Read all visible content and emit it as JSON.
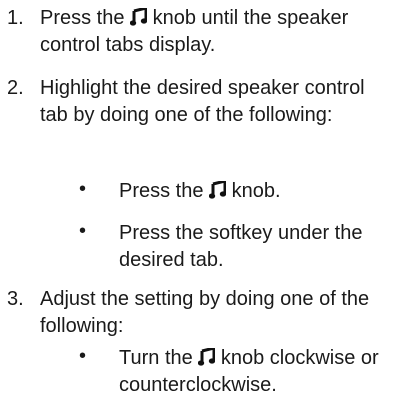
{
  "steps": [
    {
      "number": "1.",
      "text_before_icon": "Press the ",
      "icon": "music-note-icon",
      "text_after_icon": " knob until the speaker control tabs display."
    },
    {
      "number": "2.",
      "text": "Highlight the desired speaker control tab by doing one of the following:",
      "bullets": [
        {
          "text_before_icon": "Press the ",
          "icon": "music-note-icon",
          "text_after_icon": " knob."
        },
        {
          "text": "Press the softkey under the desired tab."
        }
      ]
    },
    {
      "number": "3.",
      "text": "Adjust the setting by doing one of the following:",
      "bullets": [
        {
          "text_before_icon": "Turn the ",
          "icon": "music-note-icon",
          "text_after_icon": " knob clockwise or counterclockwise."
        }
      ]
    }
  ],
  "bullet_symbol": "•"
}
